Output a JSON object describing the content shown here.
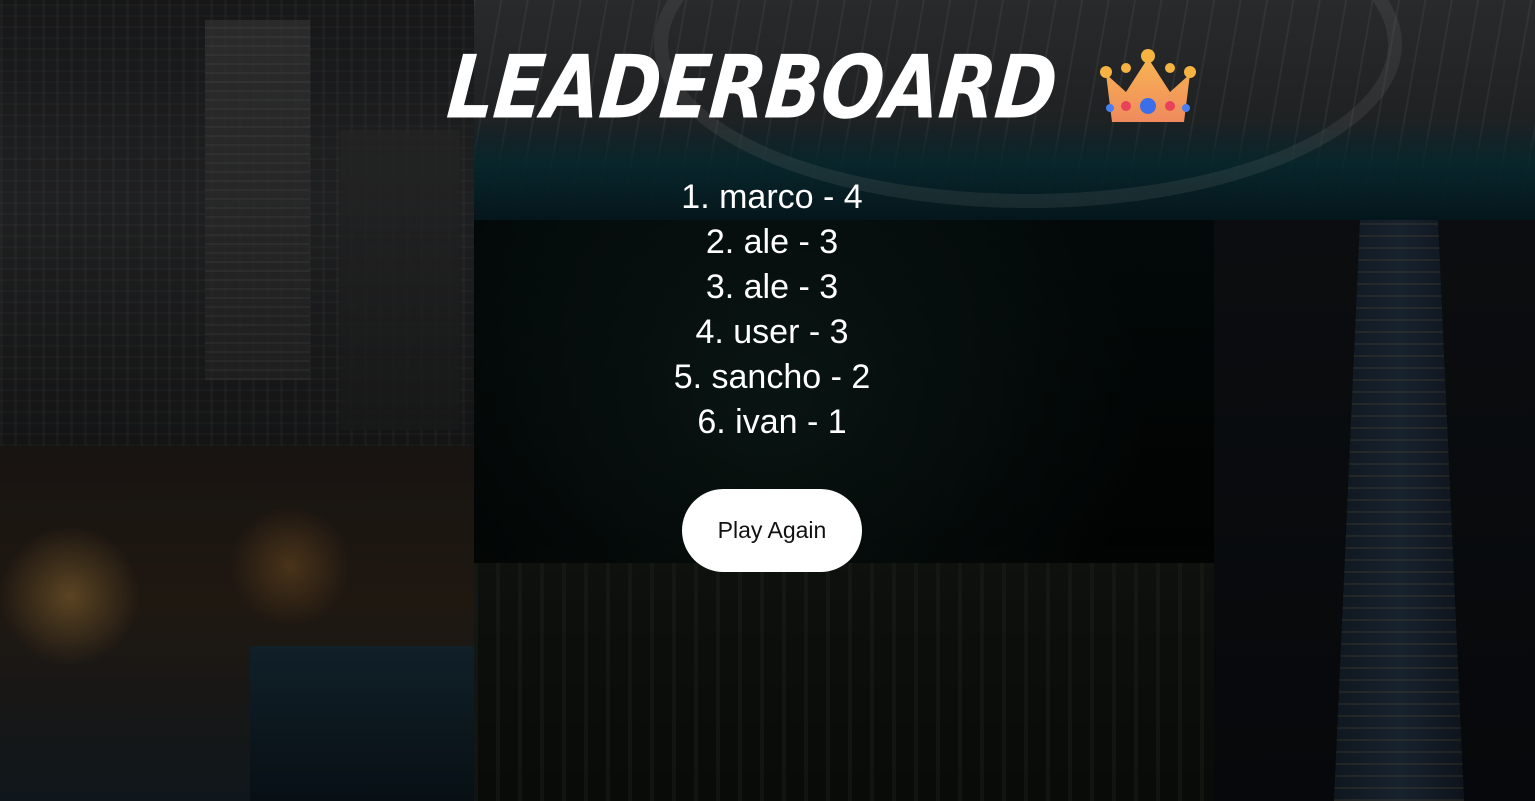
{
  "page": {
    "title": "LEADERBOARD",
    "title_icon": "crown-icon"
  },
  "leaderboard": {
    "entries": [
      {
        "text": "1. marco - 4"
      },
      {
        "text": "2. ale - 3"
      },
      {
        "text": "3. ale - 3"
      },
      {
        "text": "4. user - 3"
      },
      {
        "text": "5. sancho - 2"
      },
      {
        "text": "6. ivan - 1"
      }
    ]
  },
  "actions": {
    "play_again_label": "Play Again"
  },
  "colors": {
    "text": "#ffffff",
    "button_bg": "#ffffff",
    "button_text": "#111111"
  }
}
